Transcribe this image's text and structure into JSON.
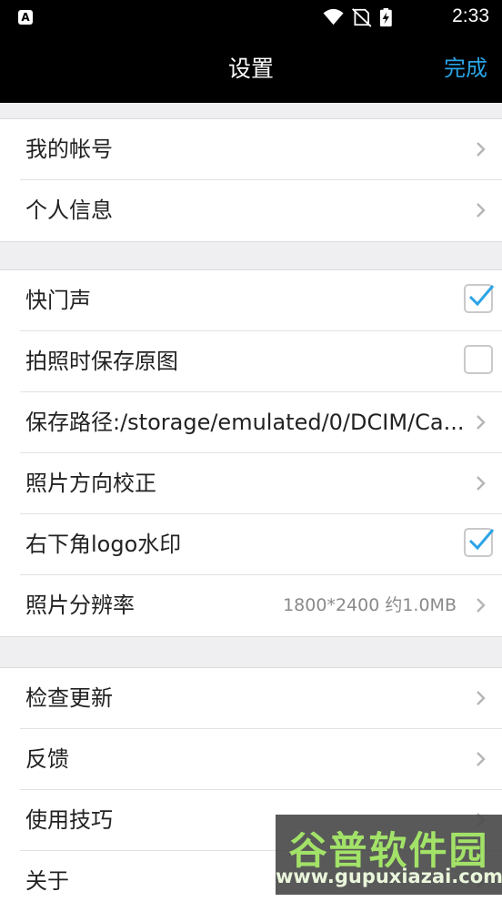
{
  "status_bar": {
    "app_icon_letter": "A",
    "time": "2:33"
  },
  "header": {
    "title": "设置",
    "done_label": "完成"
  },
  "sections": [
    {
      "items": [
        {
          "label": "我的帐号",
          "control": "chevron"
        },
        {
          "label": "个人信息",
          "control": "chevron"
        }
      ]
    },
    {
      "items": [
        {
          "label": "快门声",
          "control": "checkbox",
          "checked": true
        },
        {
          "label": "拍照时保存原图",
          "control": "checkbox",
          "checked": false
        },
        {
          "label": "保存路径:/storage/emulated/0/DCIM/Ca...",
          "control": "chevron"
        },
        {
          "label": "照片方向校正",
          "control": "chevron"
        },
        {
          "label": "右下角logo水印",
          "control": "checkbox",
          "checked": true
        },
        {
          "label": "照片分辨率",
          "value": "1800*2400 约1.0MB",
          "control": "chevron"
        }
      ]
    },
    {
      "items": [
        {
          "label": "检查更新",
          "control": "chevron"
        },
        {
          "label": "反馈",
          "control": "chevron"
        },
        {
          "label": "使用技巧",
          "control": "chevron"
        },
        {
          "label": "关于",
          "control": "chevron"
        }
      ]
    }
  ],
  "watermark": {
    "line1": "谷普软件园",
    "line2": "www.gupuxiazai.com"
  },
  "colors": {
    "accent": "#2aa4e6",
    "header_bg": "#000000",
    "page_bg": "#efeff1",
    "check": "#2aa4e6"
  }
}
